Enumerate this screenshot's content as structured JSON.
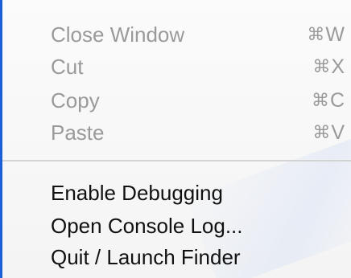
{
  "menu": {
    "items": [
      {
        "label": "Close Window",
        "shortcut_symbol": "⌘",
        "shortcut_key": "W",
        "enabled": false
      },
      {
        "label": "Cut",
        "shortcut_symbol": "⌘",
        "shortcut_key": "X",
        "enabled": false
      },
      {
        "label": "Copy",
        "shortcut_symbol": "⌘",
        "shortcut_key": "C",
        "enabled": false
      },
      {
        "label": "Paste",
        "shortcut_symbol": "⌘",
        "shortcut_key": "V",
        "enabled": false
      },
      {
        "label": "Enable Debugging",
        "enabled": true
      },
      {
        "label": "Open Console Log...",
        "enabled": true
      },
      {
        "label": "Quit / Launch Finder",
        "enabled": true
      }
    ],
    "colors": {
      "disabled_text": "#9a9a9a",
      "enabled_text": "#111111",
      "separator": "#d3d3d3",
      "accent": "#1a5fd6"
    }
  }
}
